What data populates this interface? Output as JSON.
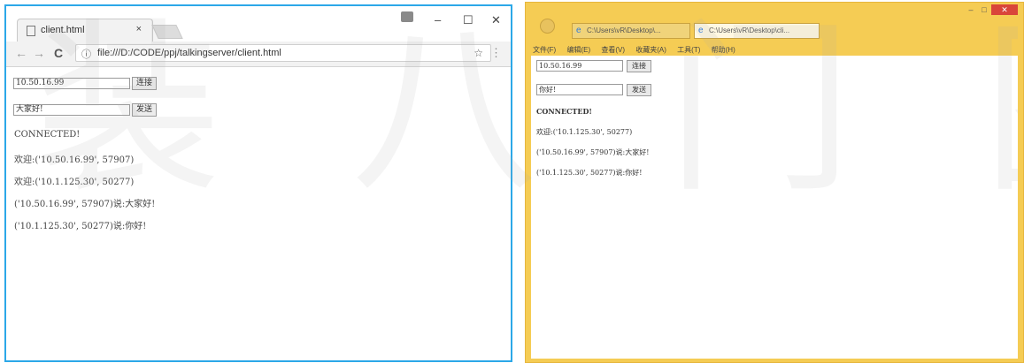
{
  "chrome": {
    "tab_title": "client.html",
    "tab_close": "×",
    "window_controls": {
      "minimize": "–",
      "maximize": "☐",
      "close": "✕"
    },
    "nav": {
      "back": "←",
      "forward": "→",
      "reload": "C"
    },
    "address_bar": {
      "info": "ⓘ",
      "url": "file:///D:/CODE/ppj/talkingserver/client.html"
    },
    "star": "☆",
    "menu": "⋮",
    "page": {
      "ip_input_value": "10.50.16.99",
      "connect_button": "连接",
      "message_input_value": "大家好!",
      "send_button": "发送",
      "lines": [
        "CONNECTED!",
        "欢迎:('10.50.16.99', 57907)",
        "欢迎:('10.1.125.30', 50277)",
        "('10.50.16.99', 57907)说:大家好!",
        "('10.1.125.30', 50277)说:你好!"
      ]
    }
  },
  "ie": {
    "tabs": [
      "C:\\Users\\vR\\Desktop\\...",
      "C:\\Users\\vR\\Desktop\\cli..."
    ],
    "tab_close": "×",
    "window_controls": {
      "minimize": "–",
      "maximize": "□",
      "close": "✕"
    },
    "menu_items": [
      "文件(F)",
      "编辑(E)",
      "查看(V)",
      "收藏夹(A)",
      "工具(T)",
      "帮助(H)"
    ],
    "page": {
      "ip_input_value": "10.50.16.99",
      "connect_button": "连接",
      "message_input_value": "你好!",
      "send_button": "发送",
      "lines": [
        "CONNECTED!",
        "欢迎:('10.1.125.30', 50277)",
        "('10.50.16.99', 57907)说:大家好!",
        "('10.1.125.30', 50277)说:你好!"
      ]
    }
  },
  "watermark": "装 八 门 图 册"
}
